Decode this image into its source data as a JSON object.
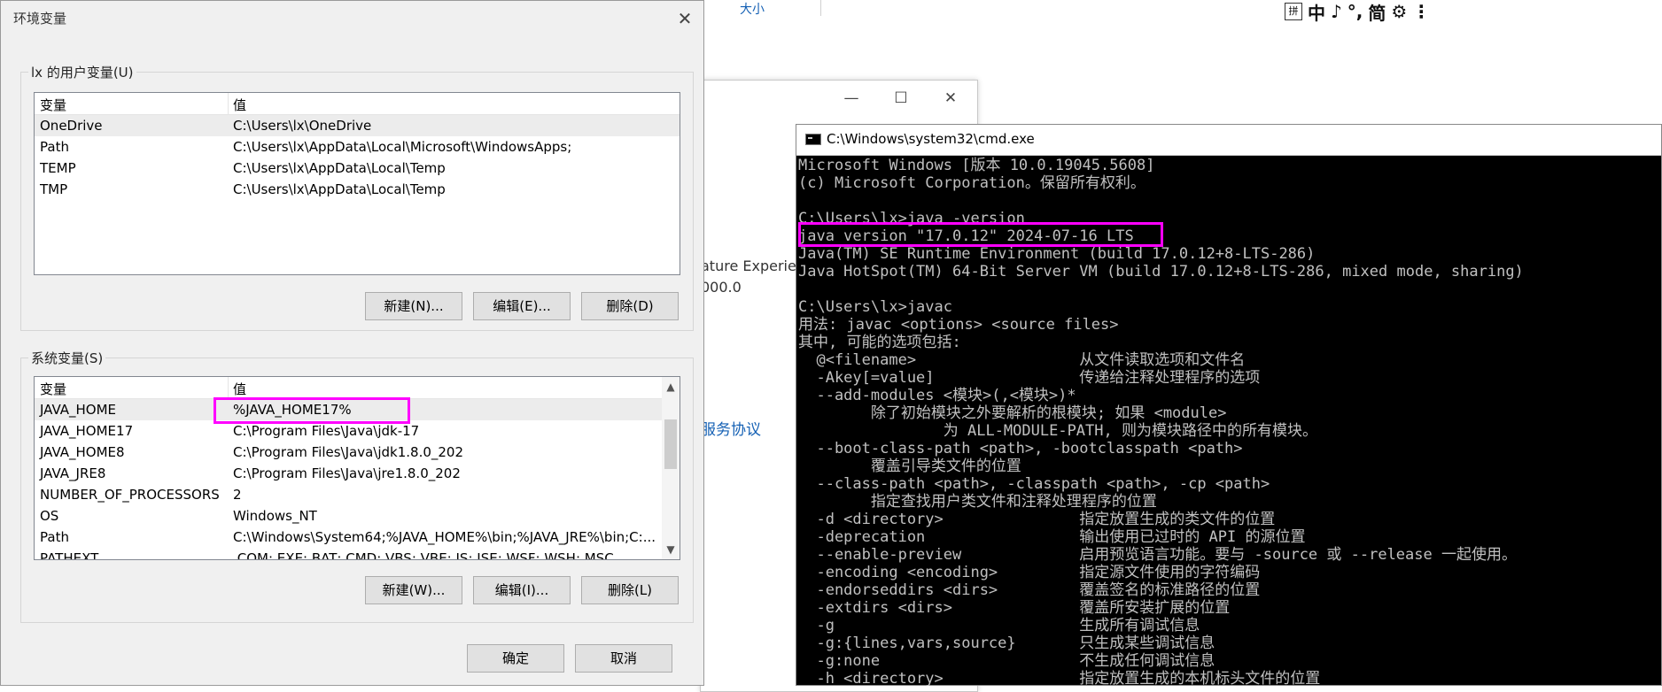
{
  "top_strip": {
    "size_peek": "大小",
    "ime_items": [
      "拼",
      "中",
      "♪",
      "°,",
      "简",
      "⚙",
      "⋮"
    ]
  },
  "bg_window": {
    "minimize": "—",
    "maximize": "☐",
    "close": "✕",
    "peek_text_1": "ature Experie",
    "peek_text_2": "000.0",
    "peek_link": "服务协议"
  },
  "env_dialog": {
    "title": "环境变量",
    "close": "✕",
    "user_vars": {
      "label": "lx 的用户变量(U)",
      "col_var": "变量",
      "col_val": "值",
      "rows": [
        {
          "name": "OneDrive",
          "value": "C:\\Users\\lx\\OneDrive"
        },
        {
          "name": "Path",
          "value": "C:\\Users\\lx\\AppData\\Local\\Microsoft\\WindowsApps;"
        },
        {
          "name": "TEMP",
          "value": "C:\\Users\\lx\\AppData\\Local\\Temp"
        },
        {
          "name": "TMP",
          "value": "C:\\Users\\lx\\AppData\\Local\\Temp"
        }
      ],
      "btn_new": "新建(N)...",
      "btn_edit": "编辑(E)...",
      "btn_delete": "删除(D)"
    },
    "system_vars": {
      "label": "系统变量(S)",
      "col_var": "变量",
      "col_val": "值",
      "rows": [
        {
          "name": "JAVA_HOME",
          "value": "%JAVA_HOME17%"
        },
        {
          "name": "JAVA_HOME17",
          "value": "C:\\Program Files\\Java\\jdk-17"
        },
        {
          "name": "JAVA_HOME8",
          "value": "C:\\Program Files\\Java\\jdk1.8.0_202"
        },
        {
          "name": "JAVA_JRE8",
          "value": "C:\\Program Files\\Java\\jre1.8.0_202"
        },
        {
          "name": "NUMBER_OF_PROCESSORS",
          "value": "2"
        },
        {
          "name": "OS",
          "value": "Windows_NT"
        },
        {
          "name": "Path",
          "value": "C:\\Windows\\System64;%JAVA_HOME%\\bin;%JAVA_JRE%\\bin;C:..."
        },
        {
          "name": "PATHEXT",
          "value": ".COM;.EXE;.BAT;.CMD;.VBS;.VBE;.JS;.JSE;.WSF;.WSH;.MSC"
        }
      ],
      "btn_new": "新建(W)...",
      "btn_edit": "编辑(I)...",
      "btn_delete": "删除(L)"
    },
    "btn_ok": "确定",
    "btn_cancel": "取消"
  },
  "cmd": {
    "title": "C:\\Windows\\system32\\cmd.exe",
    "lines": [
      "Microsoft Windows [版本 10.0.19045.5608]",
      "(c) Microsoft Corporation。保留所有权利。",
      "",
      "C:\\Users\\lx>java -version",
      "java version \"17.0.12\" 2024-07-16 LTS",
      "Java(TM) SE Runtime Environment (build 17.0.12+8-LTS-286)",
      "Java HotSpot(TM) 64-Bit Server VM (build 17.0.12+8-LTS-286, mixed mode, sharing)",
      "",
      "C:\\Users\\lx>javac",
      "用法: javac <options> <source files>",
      "其中, 可能的选项包括:",
      "  @<filename>                  从文件读取选项和文件名",
      "  -Akey[=value]                传递给注释处理程序的选项",
      "  --add-modules <模块>(,<模块>)*",
      "        除了初始模块之外要解析的根模块; 如果 <module>",
      "                为 ALL-MODULE-PATH, 则为模块路径中的所有模块。",
      "  --boot-class-path <path>, -bootclasspath <path>",
      "        覆盖引导类文件的位置",
      "  --class-path <path>, -classpath <path>, -cp <path>",
      "        指定查找用户类文件和注释处理程序的位置",
      "  -d <directory>               指定放置生成的类文件的位置",
      "  -deprecation                 输出使用已过时的 API 的源位置",
      "  --enable-preview             启用预览语言功能。要与 -source 或 --release 一起使用。",
      "  -encoding <encoding>         指定源文件使用的字符编码",
      "  -endorseddirs <dirs>         覆盖签名的标准路径的位置",
      "  -extdirs <dirs>              覆盖所安装扩展的位置",
      "  -g                           生成所有调试信息",
      "  -g:{lines,vars,source}       只生成某些调试信息",
      "  -g:none                      不生成任何调试信息",
      "  -h <directory>               指定放置生成的本机标头文件的位置"
    ]
  },
  "colors": {
    "highlight": "#ff00ff",
    "link": "#1460b4",
    "console_bg": "#000000",
    "console_fg": "#c0c0c0"
  }
}
